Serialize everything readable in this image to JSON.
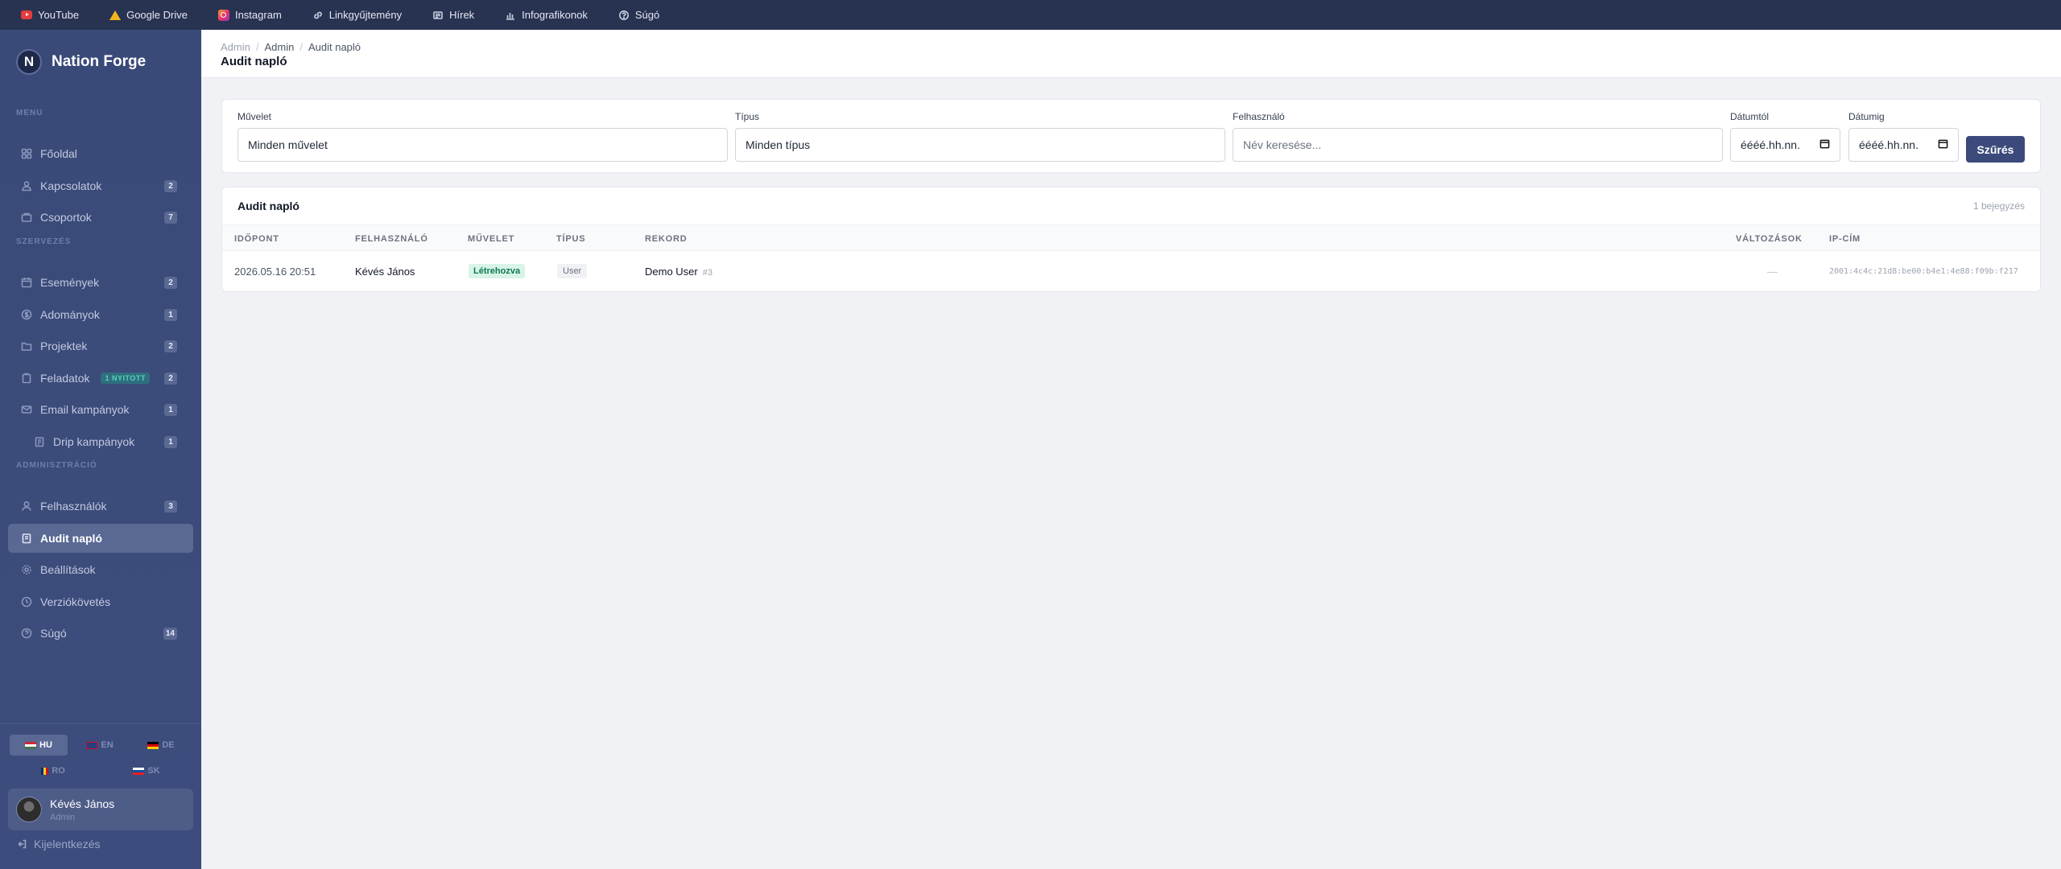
{
  "bookmarks": [
    {
      "label": "YouTube",
      "icon": "youtube-icon"
    },
    {
      "label": "Google Drive",
      "icon": "google-drive-icon"
    },
    {
      "label": "Instagram",
      "icon": "instagram-icon"
    },
    {
      "label": "Linkgyűjtemény",
      "icon": "link-icon"
    },
    {
      "label": "Hírek",
      "icon": "news-icon"
    },
    {
      "label": "Infografikonok",
      "icon": "chart-icon"
    },
    {
      "label": "Súgó",
      "icon": "help-icon"
    }
  ],
  "brand": {
    "logo_letter": "N",
    "name": "Nation Forge"
  },
  "sidebar": {
    "sections": {
      "menu": "MENU",
      "org": "SZERVEZÉS",
      "admin": "ADMINISZTRÁCIÓ"
    },
    "items": [
      {
        "label": "Főoldal",
        "badge": ""
      },
      {
        "label": "Kapcsolatok",
        "badge": "2"
      },
      {
        "label": "Csoportok",
        "badge": "7"
      },
      {
        "label": "Események",
        "badge": "2"
      },
      {
        "label": "Adományok",
        "badge": "1"
      },
      {
        "label": "Projektek",
        "badge": "2"
      },
      {
        "label": "Feladatok",
        "badge": "2",
        "tag": "1 NYITOTT"
      },
      {
        "label": "Email kampányok",
        "badge": "1"
      },
      {
        "label": "Drip kampányok",
        "badge": "1"
      },
      {
        "label": "Felhasználók",
        "badge": "3"
      },
      {
        "label": "Audit napló",
        "badge": ""
      },
      {
        "label": "Beállítások",
        "badge": ""
      },
      {
        "label": "Verziókövetés",
        "badge": ""
      },
      {
        "label": "Súgó",
        "badge": "14"
      }
    ],
    "active_item": "Audit napló",
    "languages": [
      "HU",
      "EN",
      "DE",
      "RO",
      "SK"
    ],
    "active_language": "HU",
    "user": {
      "name": "Kévés János",
      "role": "Admin"
    },
    "logout": "Kijelentkezés"
  },
  "header": {
    "breadcrumbs": [
      "Admin",
      "Admin",
      "Audit napló"
    ],
    "title": "Audit napló"
  },
  "filters": {
    "action": {
      "label": "Művelet",
      "value": "Minden művelet"
    },
    "type": {
      "label": "Típus",
      "value": "Minden típus"
    },
    "user": {
      "label": "Felhasználó",
      "placeholder": "Név keresése..."
    },
    "date_from": {
      "label": "Dátumtól",
      "placeholder": "éééé.hh.nn."
    },
    "date_to": {
      "label": "Dátumig",
      "placeholder": "éééé.hh.nn."
    },
    "submit": "Szűrés"
  },
  "table": {
    "title": "Audit napló",
    "count": "1 bejegyzés",
    "columns": [
      "IDŐPONT",
      "FELHASZNÁLÓ",
      "MŰVELET",
      "TÍPUS",
      "REKORD",
      "VÁLTOZÁSOK",
      "IP-CÍM"
    ],
    "rows": [
      {
        "time": "2026.05.16 20:51",
        "user": "Kévés János",
        "action": "Létrehozva",
        "type": "User",
        "record": "Demo User",
        "record_id": "#3",
        "changes": "—",
        "ip": "2001:4c4c:21d8:be00:b4e1:4e88:f09b:f217"
      }
    ]
  },
  "colors": {
    "sidebar": "#3a4a78",
    "topbar": "#283352",
    "accent": "#3b4a7a",
    "success_bg": "#d8f3e7",
    "success_text": "#0e7a4f"
  }
}
